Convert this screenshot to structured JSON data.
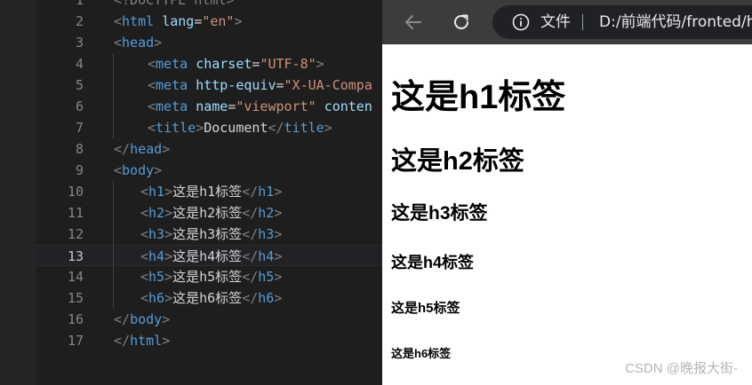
{
  "editor": {
    "current_line": 13,
    "lines": [
      {
        "num": "1",
        "tokens": [
          {
            "t": "<!DOCTYPE html>",
            "c": "punc"
          }
        ]
      },
      {
        "num": "2",
        "tokens": [
          {
            "t": "<",
            "c": "punc"
          },
          {
            "t": "html",
            "c": "tag"
          },
          {
            "t": " ",
            "c": "text"
          },
          {
            "t": "lang",
            "c": "attr"
          },
          {
            "t": "=",
            "c": "eq"
          },
          {
            "t": "\"en\"",
            "c": "str"
          },
          {
            "t": ">",
            "c": "punc"
          }
        ]
      },
      {
        "num": "3",
        "tokens": [
          {
            "t": "<",
            "c": "punc"
          },
          {
            "t": "head",
            "c": "tag"
          },
          {
            "t": ">",
            "c": "punc"
          }
        ]
      },
      {
        "num": "4",
        "tokens": [
          {
            "t": "<",
            "c": "punc"
          },
          {
            "t": "meta",
            "c": "tag"
          },
          {
            "t": " ",
            "c": "text"
          },
          {
            "t": "charset",
            "c": "attr"
          },
          {
            "t": "=",
            "c": "eq"
          },
          {
            "t": "\"UTF-8\"",
            "c": "str"
          },
          {
            "t": ">",
            "c": "punc"
          }
        ]
      },
      {
        "num": "5",
        "tokens": [
          {
            "t": "<",
            "c": "punc"
          },
          {
            "t": "meta",
            "c": "tag"
          },
          {
            "t": " ",
            "c": "text"
          },
          {
            "t": "http-equiv",
            "c": "attr"
          },
          {
            "t": "=",
            "c": "eq"
          },
          {
            "t": "\"X-UA-Compa",
            "c": "str"
          }
        ]
      },
      {
        "num": "6",
        "tokens": [
          {
            "t": "<",
            "c": "punc"
          },
          {
            "t": "meta",
            "c": "tag"
          },
          {
            "t": " ",
            "c": "text"
          },
          {
            "t": "name",
            "c": "attr"
          },
          {
            "t": "=",
            "c": "eq"
          },
          {
            "t": "\"viewport\"",
            "c": "str"
          },
          {
            "t": " ",
            "c": "text"
          },
          {
            "t": "conten",
            "c": "attr"
          }
        ]
      },
      {
        "num": "7",
        "tokens": [
          {
            "t": "<",
            "c": "punc"
          },
          {
            "t": "title",
            "c": "tag"
          },
          {
            "t": ">",
            "c": "punc"
          },
          {
            "t": "Document",
            "c": "text"
          },
          {
            "t": "</",
            "c": "punc"
          },
          {
            "t": "title",
            "c": "tag"
          },
          {
            "t": ">",
            "c": "punc"
          }
        ]
      },
      {
        "num": "8",
        "tokens": [
          {
            "t": "</",
            "c": "punc"
          },
          {
            "t": "head",
            "c": "tag"
          },
          {
            "t": ">",
            "c": "punc"
          }
        ]
      },
      {
        "num": "9",
        "tokens": [
          {
            "t": "<",
            "c": "punc"
          },
          {
            "t": "body",
            "c": "tag"
          },
          {
            "t": ">",
            "c": "punc"
          }
        ]
      },
      {
        "num": "10",
        "tokens": [
          {
            "t": "<",
            "c": "punc"
          },
          {
            "t": "h1",
            "c": "tag"
          },
          {
            "t": ">",
            "c": "punc"
          },
          {
            "t": "这是h1标签",
            "c": "text"
          },
          {
            "t": "</",
            "c": "punc"
          },
          {
            "t": "h1",
            "c": "tag"
          },
          {
            "t": ">",
            "c": "punc"
          }
        ]
      },
      {
        "num": "11",
        "tokens": [
          {
            "t": "<",
            "c": "punc"
          },
          {
            "t": "h2",
            "c": "tag"
          },
          {
            "t": ">",
            "c": "punc"
          },
          {
            "t": "这是h2标签",
            "c": "text"
          },
          {
            "t": "</",
            "c": "punc"
          },
          {
            "t": "h2",
            "c": "tag"
          },
          {
            "t": ">",
            "c": "punc"
          }
        ]
      },
      {
        "num": "12",
        "tokens": [
          {
            "t": "<",
            "c": "punc"
          },
          {
            "t": "h3",
            "c": "tag"
          },
          {
            "t": ">",
            "c": "punc"
          },
          {
            "t": "这是h3标签",
            "c": "text"
          },
          {
            "t": "</",
            "c": "punc"
          },
          {
            "t": "h3",
            "c": "tag"
          },
          {
            "t": ">",
            "c": "punc"
          }
        ]
      },
      {
        "num": "13",
        "tokens": [
          {
            "t": "<",
            "c": "punc"
          },
          {
            "t": "h4",
            "c": "tag"
          },
          {
            "t": ">",
            "c": "punc"
          },
          {
            "t": "这是h4标签",
            "c": "text"
          },
          {
            "t": "</",
            "c": "punc"
          },
          {
            "t": "h4",
            "c": "tag"
          },
          {
            "t": ">",
            "c": "punc"
          }
        ]
      },
      {
        "num": "14",
        "tokens": [
          {
            "t": "<",
            "c": "punc"
          },
          {
            "t": "h5",
            "c": "tag"
          },
          {
            "t": ">",
            "c": "punc"
          },
          {
            "t": "这是h5标签",
            "c": "text"
          },
          {
            "t": "</",
            "c": "punc"
          },
          {
            "t": "h5",
            "c": "tag"
          },
          {
            "t": ">",
            "c": "punc"
          }
        ]
      },
      {
        "num": "15",
        "tokens": [
          {
            "t": "<",
            "c": "punc"
          },
          {
            "t": "h6",
            "c": "tag"
          },
          {
            "t": ">",
            "c": "punc"
          },
          {
            "t": "这是h6标签",
            "c": "text"
          },
          {
            "t": "</",
            "c": "punc"
          },
          {
            "t": "h6",
            "c": "tag"
          },
          {
            "t": ">",
            "c": "punc"
          }
        ]
      },
      {
        "num": "16",
        "tokens": [
          {
            "t": "</",
            "c": "punc"
          },
          {
            "t": "body",
            "c": "tag"
          },
          {
            "t": ">",
            "c": "punc"
          }
        ]
      },
      {
        "num": "17",
        "tokens": [
          {
            "t": "</",
            "c": "punc"
          },
          {
            "t": "html",
            "c": "tag"
          },
          {
            "t": ">",
            "c": "punc"
          }
        ]
      }
    ]
  },
  "browser": {
    "back_icon": "arrow-left-icon",
    "reload_icon": "reload-icon",
    "info_icon": "info-icon",
    "address": {
      "scheme_label": "文件",
      "url": "D:/前端代码/fronted/h"
    },
    "page": {
      "h1": "这是h1标签",
      "h2": "这是h2标签",
      "h3": "这是h3标签",
      "h4": "这是h4标签",
      "h5": "这是h5标签",
      "h6": "这是h6标签"
    }
  },
  "watermark": "CSDN @晚报大街-",
  "colors": {
    "editor_bg": "#1e1e1e",
    "tag": "#569cd6",
    "attribute": "#9cdcfe",
    "string": "#ce9178",
    "punctuation": "#808080",
    "text": "#d4d4d4",
    "browser_toolbar": "#3c3c3c"
  }
}
